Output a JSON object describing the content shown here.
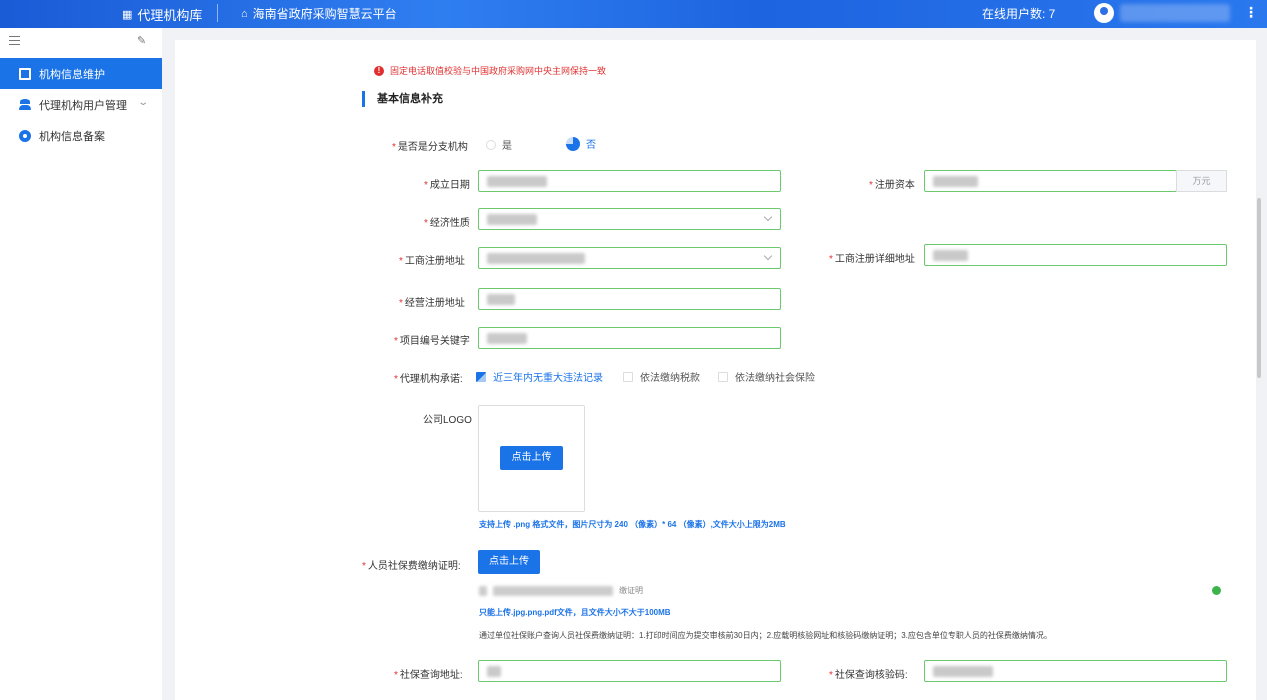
{
  "topbar": {
    "system_name": "代理机构库",
    "platform_name": "海南省政府采购智慧云平台",
    "online_users": "在线用户数: 7"
  },
  "sidebar": {
    "items": [
      {
        "label": "机构信息维护"
      },
      {
        "label": "代理机构用户管理"
      },
      {
        "label": "机构信息备案"
      }
    ]
  },
  "form": {
    "notice": "固定电话取值校验与中国政府采购网中央主网保持一致",
    "section_title": "基本信息补充",
    "branch_label": "是否是分支机构",
    "branch_yes": "是",
    "branch_no": "否",
    "found_date_label": "成立日期",
    "capital_label": "注册资本",
    "capital_unit": "万元",
    "econ_label": "经济性质",
    "reg_addr_label": "工商注册地址",
    "reg_addr_detail_label": "工商注册详细地址",
    "biz_addr_label": "经营注册地址",
    "project_kw_label": "项目编号关键字",
    "commit_label": "代理机构承诺:",
    "commit_options": [
      "近三年内无重大违法记录",
      "依法缴纳税款",
      "依法缴纳社会保险"
    ],
    "logo_label": "公司LOGO",
    "upload_btn": "点击上传",
    "logo_hint": "支持上传 .png 格式文件，图片尺寸为 240 （像素）* 64 （像素）,文件大小上限为2MB",
    "social_label": "人员社保费缴纳证明:",
    "social_upload_btn": "点击上传",
    "file_tail": "缴证明",
    "social_hint": "只能上传.jpg.png.pdf文件，且文件大小不大于100MB",
    "social_desc": "通过单位社保账户查询人员社保费缴纳证明：1.打印时间应为提交审核前30日内；2.应载明核验网址和核验码缴纳证明；3.应包含单位专职人员的社保费缴纳情况。",
    "social_query_addr_label": "社保查询地址:",
    "social_query_code_label": "社保查询核验码:"
  },
  "colors": {
    "accent": "#1b73e8",
    "success_border": "#6cc86c",
    "required": "#e03333"
  }
}
